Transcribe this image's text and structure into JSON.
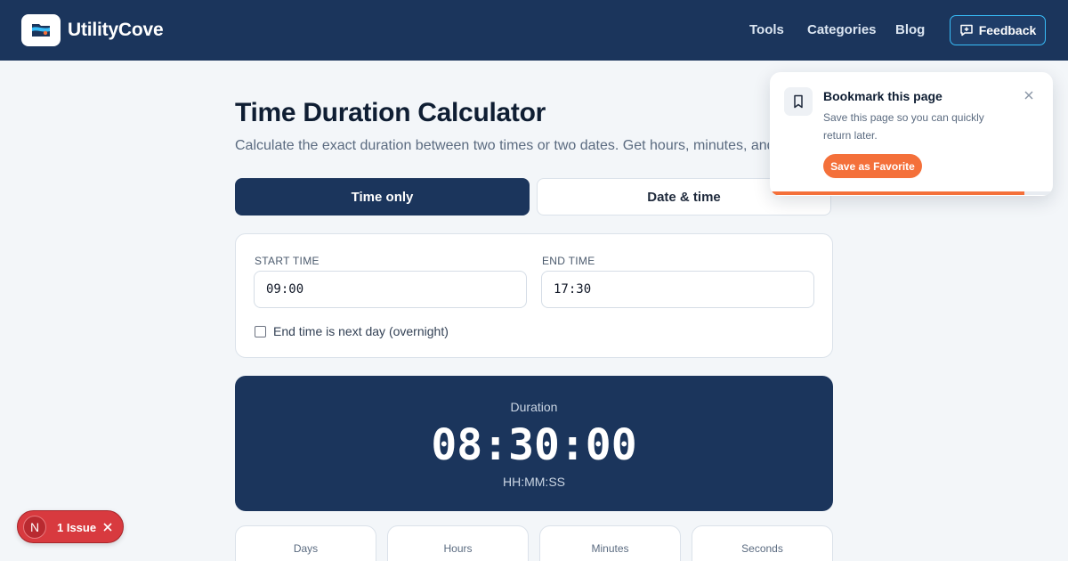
{
  "header": {
    "brand": "UtilityCove",
    "nav": [
      "Tools",
      "Categories",
      "Blog"
    ],
    "feedback_label": "Feedback",
    "background": "#1b355c"
  },
  "main": {
    "title": "Time Duration Calculator",
    "subtitle": "Calculate the exact duration between two times or two dates. Get hours, minutes, and seconds.",
    "tabs": [
      {
        "label": "Time only",
        "active": true
      },
      {
        "label": "Date & time",
        "active": false
      }
    ],
    "inputs": {
      "start_label": "START TIME",
      "start_value": "09:00",
      "end_label": "END TIME",
      "end_value": "17:30",
      "overnight_label": "End time is next day (overnight)",
      "overnight_checked": false
    },
    "result": {
      "label": "Duration",
      "value": "08:30:00",
      "format": "HH:MM:SS"
    },
    "stats": [
      "Days",
      "Hours",
      "Minutes",
      "Seconds"
    ]
  },
  "popup": {
    "title": "Bookmark this page",
    "text": "Save this page so you can quickly return later.",
    "button_label": "Save as Favorite",
    "accent": "#f4703a",
    "progress": 0.9
  },
  "issue_badge": {
    "initial": "N",
    "label": "1 Issue",
    "color": "#d83a3f"
  }
}
